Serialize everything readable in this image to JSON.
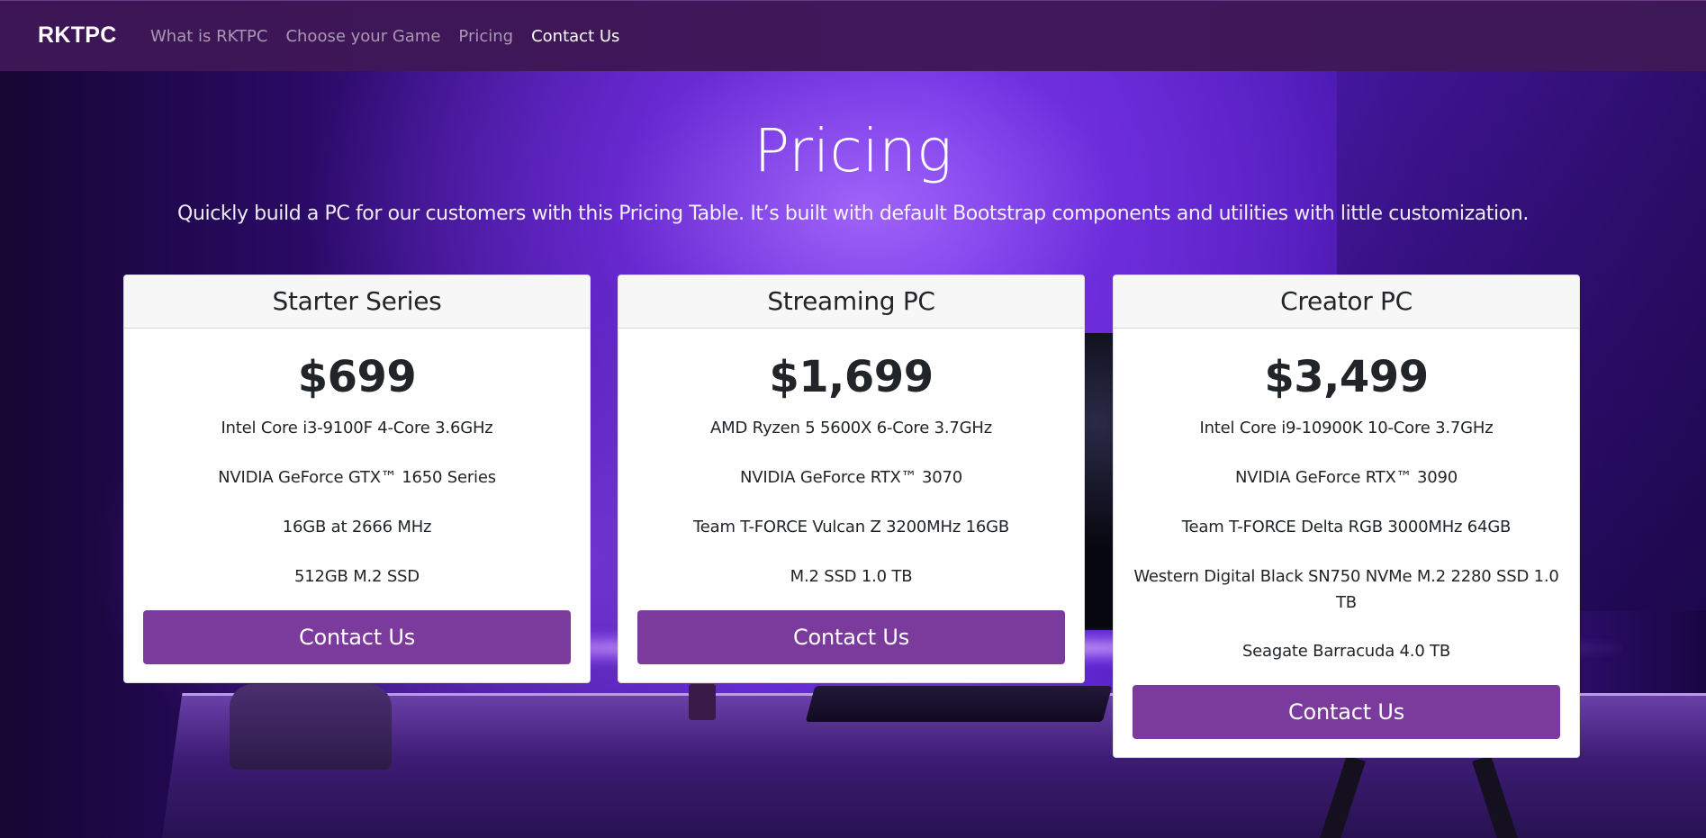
{
  "navbar": {
    "brand": "RKTPC",
    "links": [
      {
        "label": "What is RKTPC",
        "active": false
      },
      {
        "label": "Choose your Game",
        "active": false
      },
      {
        "label": "Pricing",
        "active": false
      },
      {
        "label": "Contact Us",
        "active": true
      }
    ]
  },
  "hero": {
    "title": "Pricing",
    "subtitle": "Quickly build a PC for our customers with this Pricing Table. It’s built with default Bootstrap components and utilities with little customization."
  },
  "cards": [
    {
      "title": "Starter Series",
      "price": "$699",
      "features": [
        "Intel Core i3-9100F 4-Core 3.6GHz",
        "NVIDIA GeForce GTX™ 1650 Series",
        "16GB at 2666 MHz",
        "512GB M.2 SSD"
      ],
      "button": "Contact Us"
    },
    {
      "title": "Streaming PC",
      "price": "$1,699",
      "features": [
        "AMD Ryzen 5 5600X 6-Core 3.7GHz",
        "NVIDIA GeForce RTX™ 3070",
        "Team T-FORCE Vulcan Z 3200MHz 16GB",
        "M.2 SSD 1.0 TB"
      ],
      "button": "Contact Us"
    },
    {
      "title": "Creator PC",
      "price": "$3,499",
      "features": [
        "Intel Core i9-10900K 10-Core 3.7GHz",
        "NVIDIA GeForce RTX™ 3090",
        "Team T-FORCE Delta RGB 3000MHz 64GB",
        "Western Digital Black SN750 NVMe M.2 2280 SSD 1.0 TB",
        "Seagate Barracuda 4.0 TB"
      ],
      "button": "Contact Us"
    }
  ],
  "colors": {
    "navbar_bg": "#41185c",
    "button_bg": "#7b3b9c",
    "card_header_bg": "#f7f7f7",
    "text_dark": "#212529"
  }
}
